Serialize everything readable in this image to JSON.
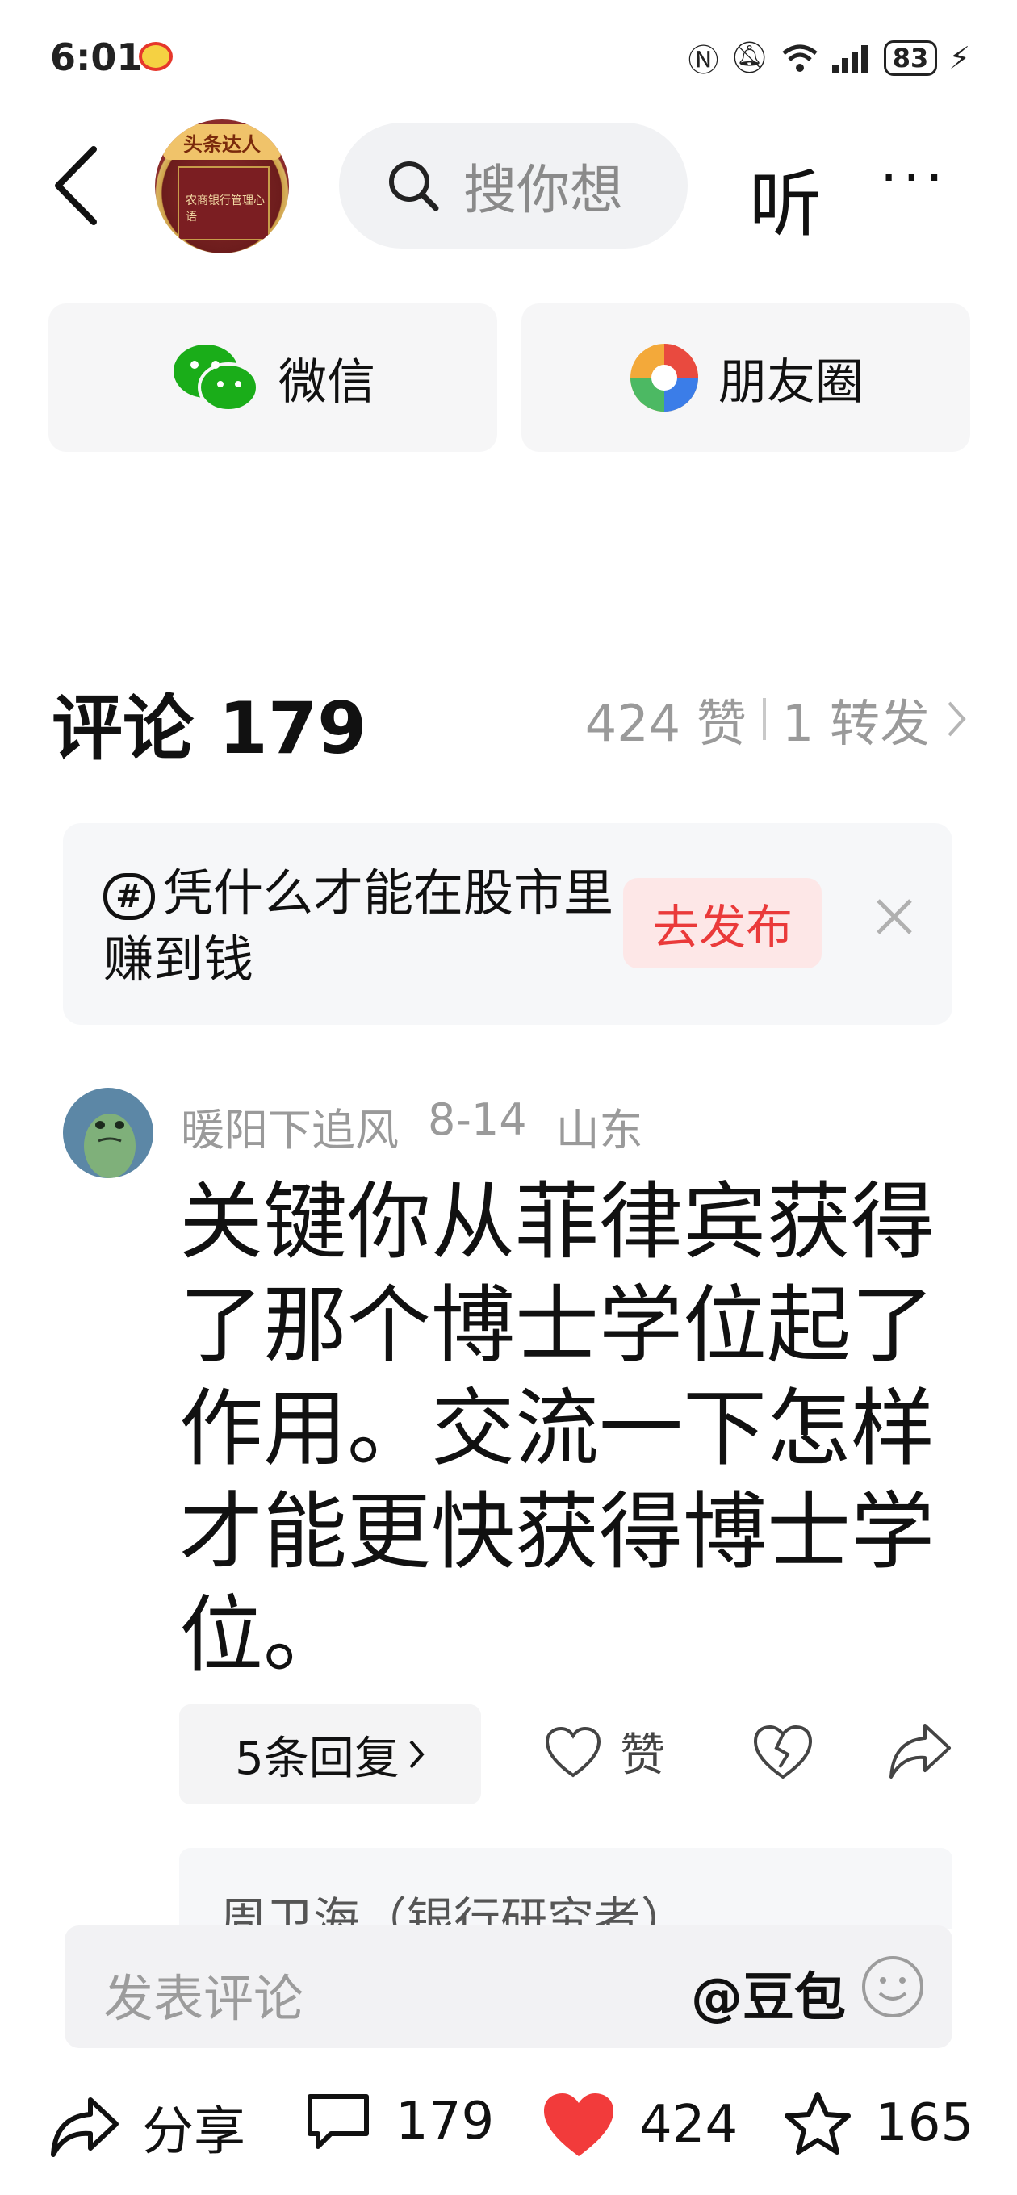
{
  "status_bar": {
    "time": "6:01",
    "battery": "83"
  },
  "nav": {
    "avatar_badge": "头条达人",
    "avatar_book_title": "农商银行管理心语",
    "search_placeholder": "搜你想",
    "listen_label": "听",
    "more_label": "···"
  },
  "share": {
    "wechat_label": "微信",
    "moments_label": "朋友圈"
  },
  "comments_header": {
    "title": "评论 179",
    "likes": "424 赞",
    "forwards": "1 转发"
  },
  "topic": {
    "text": "凭什么才能在股市里赚到钱",
    "publish_label": "去发布"
  },
  "comment": {
    "username": "暖阳下追风",
    "date": "8-14",
    "location": "山东",
    "body": "关键你从菲律宾获得了那个博士学位起了作用。交流一下怎样才能更快获得博士学位。",
    "replies_label": "5条回复",
    "like_label": "赞",
    "reply_preview": "周卫海（银行研究者）"
  },
  "input": {
    "placeholder": "发表评论",
    "doubao": "@豆包"
  },
  "bottom_bar": {
    "share_label": "分享",
    "comment_count": "179",
    "like_count": "424",
    "fav_count": "165"
  },
  "colors": {
    "accent_red": "#ea3a3a",
    "like_red": "#f23b3b",
    "wechat_green": "#1aad19"
  }
}
